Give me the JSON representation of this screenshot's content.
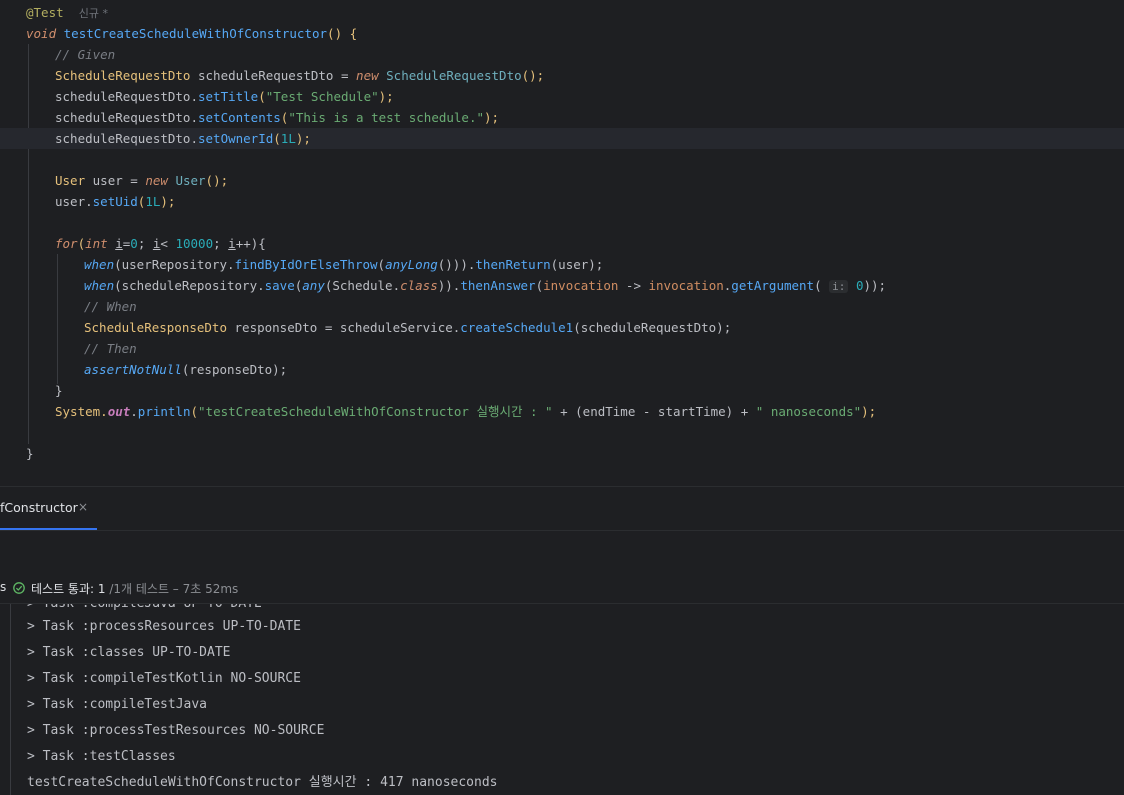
{
  "editor": {
    "annotation": "@Test",
    "annotation_hint": "신규 *",
    "method_sig": {
      "kw": "void",
      "name": "testCreateScheduleWithOfConstructor",
      "rest": "() {"
    },
    "given_comment": "// Given",
    "l_dto": {
      "type": "ScheduleRequestDto",
      "var": "scheduleRequestDto",
      "eq": " = ",
      "new": "new",
      "ctor": "ScheduleRequestDto",
      "end": "();"
    },
    "l_title": {
      "obj": "scheduleRequestDto",
      "dot": ".",
      "m": "setTitle",
      "open": "(",
      "arg": "\"Test Schedule\"",
      "close": ");"
    },
    "l_contents": {
      "obj": "scheduleRequestDto",
      "dot": ".",
      "m": "setContents",
      "open": "(",
      "arg": "\"This is a test schedule.\"",
      "close": ");"
    },
    "l_owner": {
      "obj": "scheduleRequestDto",
      "dot": ".",
      "m": "setOwnerId",
      "open": "(",
      "arg": "1L",
      "close": ");"
    },
    "l_user": {
      "type": "User",
      "var": "user",
      "eq": " = ",
      "new": "new",
      "ctor": "User",
      "end": "();"
    },
    "l_uid": {
      "obj": "user",
      "dot": ".",
      "m": "setUid",
      "open": "(",
      "arg": "1L",
      "close": ");"
    },
    "l_for": {
      "for": "for",
      "open": "(",
      "int": "int",
      "i1": "i",
      "eq0": "=",
      "zero": "0",
      "semi1": "; ",
      "i2": "i",
      "lt": "< ",
      "max": "10000",
      "semi2": "; ",
      "i3": "i",
      "inc": "++){"
    },
    "l_when1": {
      "when": "when",
      "a": "(userRepository.",
      "m": "findByIdOrElseThrow",
      "b": "(",
      "any": "anyLong",
      "c": "())).",
      "then": "thenReturn",
      "d": "(user);"
    },
    "l_when2": {
      "when": "when",
      "a": "(scheduleRepository.",
      "m": "save",
      "b": "(",
      "any": "any",
      "c": "(Schedule.",
      "cls": "class",
      "d": ")).",
      "then": "thenAnswer",
      "e": "(",
      "inv": "invocation",
      "arrow": " -> ",
      "inv2": "invocation",
      "f": ".",
      "get": "getArgument",
      "g": "( ",
      "hint": "i:",
      "zero": "0",
      "h": "));"
    },
    "when_comment": "// When",
    "l_resp": {
      "type": "ScheduleResponseDto",
      "var": " responseDto = scheduleService.",
      "m": "createSchedule1",
      "rest": "(scheduleRequestDto);"
    },
    "then_comment": "// Then",
    "l_assert": {
      "m": "assertNotNull",
      "rest": "(responseDto);"
    },
    "close_for": "}",
    "l_print": {
      "sys": "System.",
      "out": "out",
      "dot": ".",
      "m": "println",
      "open": "(",
      "str1": "\"testCreateScheduleWithOfConstructor 실행시간 : \"",
      "mid": " + (endTime - startTime) + ",
      "str2": "\" nanoseconds\"",
      "close": ");"
    },
    "close_method": "}"
  },
  "panel": {
    "tab_label": "fConstructor",
    "tab_close": "×",
    "status_prefix": "s",
    "status_main": "테스트 통과: 1",
    "status_sub": " /1개 테스트 – 7초 52ms",
    "output_lines": [
      "> Task :compileJava UP-TO-DATE",
      "> Task :processResources UP-TO-DATE",
      "> Task :classes UP-TO-DATE",
      "> Task :compileTestKotlin NO-SOURCE",
      "> Task :compileTestJava",
      "> Task :processTestResources NO-SOURCE",
      "> Task :testClasses",
      "testCreateScheduleWithOfConstructor 실행시간 : 417 nanoseconds"
    ]
  },
  "colors": {
    "accent": "#3574f0",
    "pass": "#5fb865",
    "bg": "#1e1f22"
  }
}
